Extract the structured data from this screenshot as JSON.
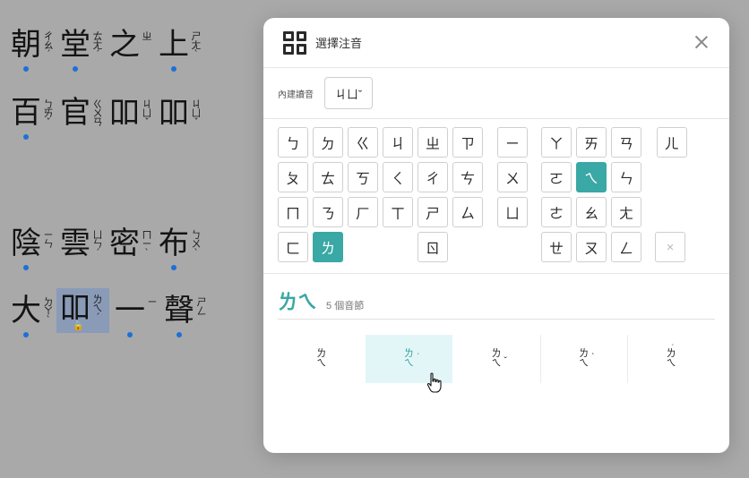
{
  "document": {
    "lines": [
      [
        {
          "char": "朝",
          "zy": [
            "ㄔ",
            "ㄠ",
            "ˊ"
          ],
          "dot": true
        },
        {
          "char": "堂",
          "zy": [
            "ㄊ",
            "ㄤ",
            "ˊ"
          ],
          "dot": true
        },
        {
          "char": "之",
          "zy": [
            "ㄓ"
          ],
          "dot": false
        },
        {
          "char": "上",
          "zy": [
            "ㄕ",
            "ㄤ",
            "ˋ"
          ],
          "dot": true
        }
      ],
      [
        {
          "char": "百",
          "zy": [
            "ㄅ",
            "ㄞ",
            "ˇ"
          ],
          "dot": true
        },
        {
          "char": "官",
          "zy": [
            "ㄍ",
            "ㄨ",
            "ㄢ"
          ],
          "dot": false
        },
        {
          "char": "吅",
          "zy": [
            "ㄐ",
            "ㄩ",
            "ˇ"
          ],
          "dot": false
        },
        {
          "char": "吅",
          "zy": [
            "ㄐ",
            "ㄩ",
            "ˇ"
          ],
          "dot": false
        }
      ],
      [
        {
          "char": "陰",
          "zy": [
            "ㄧ",
            "ㄣ"
          ],
          "dot": true
        },
        {
          "char": "雲",
          "zy": [
            "ㄩ",
            "ㄣ",
            "ˊ"
          ],
          "dot": false
        },
        {
          "char": "密",
          "zy": [
            "ㄇ",
            "ㄧ",
            "ˋ"
          ],
          "dot": false
        },
        {
          "char": "布",
          "zy": [
            "ㄅ",
            "ㄨ",
            "ˋ"
          ],
          "dot": true
        }
      ],
      [
        {
          "char": "大",
          "zy": [
            "ㄉ",
            "ㄚ",
            "ˋ"
          ],
          "dot": true
        },
        {
          "char": "吅",
          "zy": [
            "ㄌ",
            "ㄟ",
            "ˊ"
          ],
          "dot": false,
          "selected": true,
          "locked": true
        },
        {
          "char": "一",
          "zy": [
            "ㄧ"
          ],
          "dot": true
        },
        {
          "char": "聲",
          "zy": [
            "ㄕ",
            "ㄥ"
          ],
          "dot": true
        }
      ]
    ]
  },
  "modal": {
    "title": "選擇注音",
    "builtin_label": "內建讀音",
    "builtin_value": "ㄐㄩˇ",
    "keys": {
      "initials": [
        "ㄅ",
        "ㄉ",
        "ㄍ",
        "ㄐ",
        "ㄓ",
        "ㄗ",
        "ㄆ",
        "ㄊ",
        "ㄎ",
        "ㄑ",
        "ㄔ",
        "ㄘ",
        "ㄇ",
        "ㄋ",
        "ㄏ",
        "ㄒ",
        "ㄕ",
        "ㄙ",
        "ㄈ",
        "ㄌ",
        "ㄖ"
      ],
      "medials": [
        "ㄧ",
        "ㄨ",
        "ㄩ"
      ],
      "finals": [
        "ㄚ",
        "ㄞ",
        "ㄢ",
        "ㄦ",
        "ㄛ",
        "ㄟ",
        "ㄣ",
        "ㄜ",
        "ㄠ",
        "ㄤ",
        "ㄝ",
        "ㄡ",
        "ㄥ"
      ],
      "clear": "×",
      "active": [
        "ㄌ",
        "ㄟ"
      ]
    },
    "result_zhuyin": "ㄌㄟ",
    "result_count": "5 個音節",
    "tones": [
      {
        "zy": [
          "ㄌ",
          "ㄟ"
        ],
        "mark": ""
      },
      {
        "zy": [
          "ㄌ",
          "ㄟ"
        ],
        "mark": "ˊ"
      },
      {
        "zy": [
          "ㄌ",
          "ㄟ"
        ],
        "mark": "ˇ"
      },
      {
        "zy": [
          "ㄌ",
          "ㄟ"
        ],
        "mark": "ˋ"
      },
      {
        "zy": [
          "ㄌ",
          "ㄟ"
        ],
        "mark": "˙"
      }
    ],
    "highlighted_tone": 1
  },
  "colors": {
    "accent": "#3aa8a5",
    "selection": "#8a9bb8",
    "dot": "#1e6fd6"
  }
}
